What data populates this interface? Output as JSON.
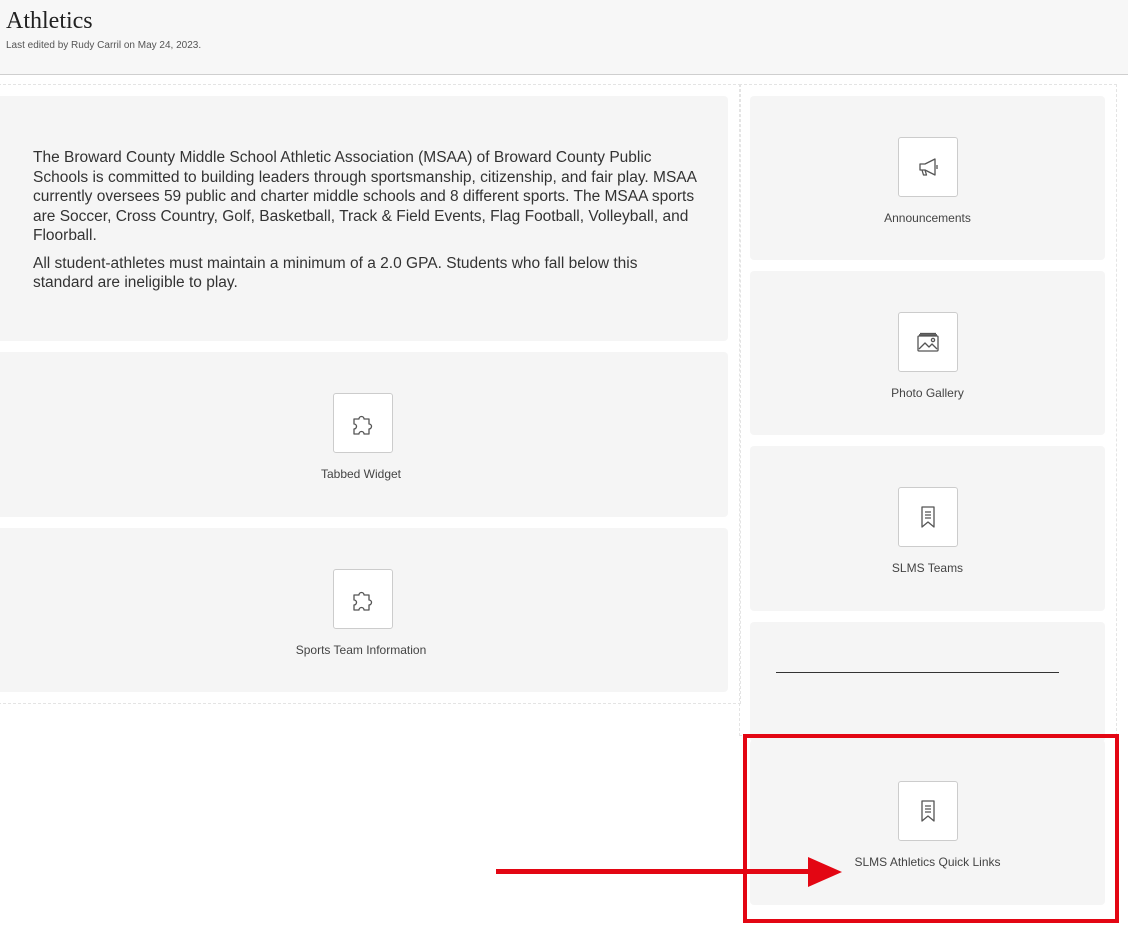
{
  "header": {
    "title": "Athletics",
    "meta": "Last edited by Rudy Carril on May 24, 2023."
  },
  "main": {
    "intro_paragraphs": [
      "The Broward County Middle School Athletic Association (MSAA) of Broward County Public Schools is committed to building leaders through sportsmanship, citizenship, and fair play. MSAA currently oversees 59 public and charter middle schools and 8 different sports. The MSAA sports are Soccer, Cross Country, Golf, Basketball, Track & Field Events, Flag Football, Volleyball, and Floorball.",
      "All student-athletes must maintain a minimum of a 2.0 GPA.  Students who fall below this standard are ineligible to play."
    ],
    "widgets": [
      {
        "label": "Tabbed Widget",
        "icon": "puzzle-icon"
      },
      {
        "label": "Sports Team Information",
        "icon": "puzzle-icon"
      }
    ]
  },
  "sidebar": {
    "widgets": [
      {
        "label": "Announcements",
        "icon": "megaphone-icon"
      },
      {
        "label": "Photo Gallery",
        "icon": "photo-gallery-icon"
      },
      {
        "label": "SLMS Teams",
        "icon": "bookmark-icon"
      },
      {
        "label": "SLMS Athletics Quick Links",
        "icon": "bookmark-icon"
      }
    ]
  },
  "annotation": {
    "highlight_color": "#e30613"
  }
}
